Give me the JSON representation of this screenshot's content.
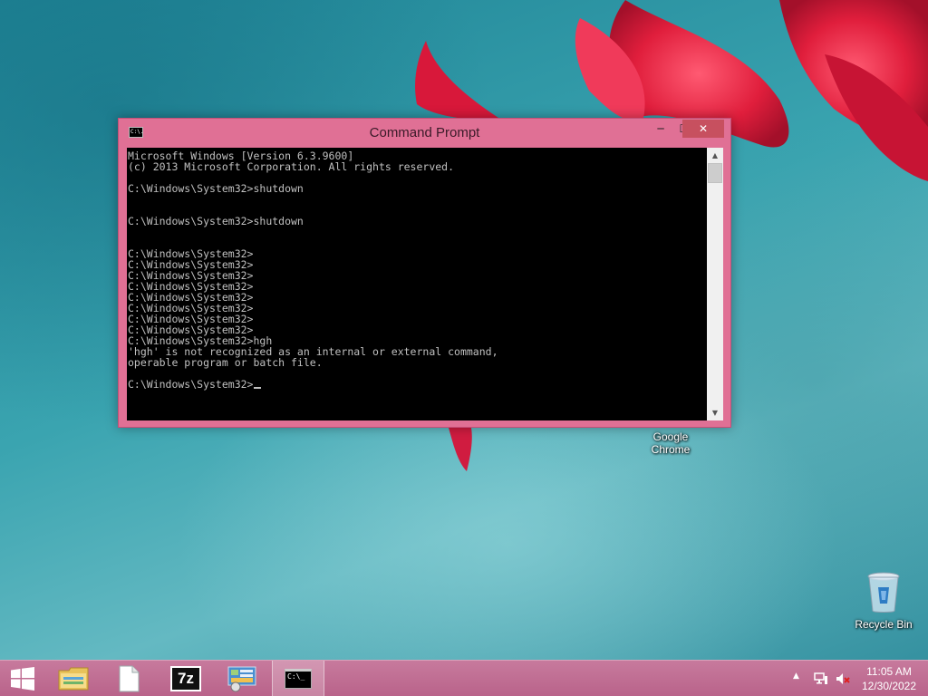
{
  "window": {
    "title": "Command Prompt",
    "controls": {
      "minimize": "─",
      "maximize": "☐",
      "close": "✕"
    },
    "icon_label": "C:\\."
  },
  "console": {
    "lines": [
      "Microsoft Windows [Version 6.3.9600]",
      "(c) 2013 Microsoft Corporation. All rights reserved.",
      "",
      "C:\\Windows\\System32>shutdown",
      "",
      "",
      "C:\\Windows\\System32>shutdown",
      "",
      "",
      "C:\\Windows\\System32>",
      "C:\\Windows\\System32>",
      "C:\\Windows\\System32>",
      "C:\\Windows\\System32>",
      "C:\\Windows\\System32>",
      "C:\\Windows\\System32>",
      "C:\\Windows\\System32>",
      "C:\\Windows\\System32>",
      "C:\\Windows\\System32>hgh",
      "'hgh' is not recognized as an internal or external command,",
      "operable program or batch file.",
      "",
      "C:\\Windows\\System32>"
    ]
  },
  "desktop": {
    "icons": [
      {
        "name": "google-chrome",
        "label_line1": "Google",
        "label_line2": "Chrome"
      },
      {
        "name": "recycle-bin",
        "label": "Recycle Bin"
      }
    ]
  },
  "taskbar": {
    "apps": [
      {
        "name": "file-explorer",
        "icon": "folder-icon"
      },
      {
        "name": "blank-document",
        "icon": "document-icon"
      },
      {
        "name": "7zip",
        "icon": "7zip-icon",
        "text": "7z"
      },
      {
        "name": "control-panel",
        "icon": "control-panel-icon"
      },
      {
        "name": "command-prompt",
        "icon": "terminal-icon",
        "text": "C:\\_",
        "active": true
      }
    ],
    "tray": {
      "chevron": "▲",
      "time": "11:05 AM",
      "date": "12/30/2022"
    }
  },
  "colors": {
    "window_frame": "#e07095",
    "console_bg": "#000000",
    "console_text": "#c0c0c0",
    "close_button": "#c7505f",
    "taskbar": "#bd6d91"
  }
}
